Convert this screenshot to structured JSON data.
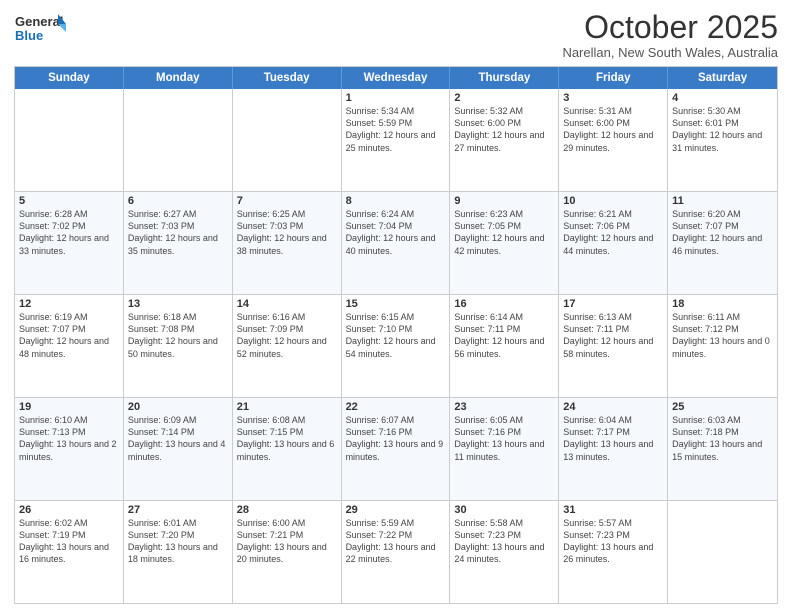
{
  "logo": {
    "line1": "General",
    "line2": "Blue"
  },
  "title": "October 2025",
  "location": "Narellan, New South Wales, Australia",
  "days_of_week": [
    "Sunday",
    "Monday",
    "Tuesday",
    "Wednesday",
    "Thursday",
    "Friday",
    "Saturday"
  ],
  "weeks": [
    [
      {
        "day": "",
        "sunrise": "",
        "sunset": "",
        "daylight": ""
      },
      {
        "day": "",
        "sunrise": "",
        "sunset": "",
        "daylight": ""
      },
      {
        "day": "",
        "sunrise": "",
        "sunset": "",
        "daylight": ""
      },
      {
        "day": "1",
        "sunrise": "Sunrise: 5:34 AM",
        "sunset": "Sunset: 5:59 PM",
        "daylight": "Daylight: 12 hours and 25 minutes."
      },
      {
        "day": "2",
        "sunrise": "Sunrise: 5:32 AM",
        "sunset": "Sunset: 6:00 PM",
        "daylight": "Daylight: 12 hours and 27 minutes."
      },
      {
        "day": "3",
        "sunrise": "Sunrise: 5:31 AM",
        "sunset": "Sunset: 6:00 PM",
        "daylight": "Daylight: 12 hours and 29 minutes."
      },
      {
        "day": "4",
        "sunrise": "Sunrise: 5:30 AM",
        "sunset": "Sunset: 6:01 PM",
        "daylight": "Daylight: 12 hours and 31 minutes."
      }
    ],
    [
      {
        "day": "5",
        "sunrise": "Sunrise: 6:28 AM",
        "sunset": "Sunset: 7:02 PM",
        "daylight": "Daylight: 12 hours and 33 minutes."
      },
      {
        "day": "6",
        "sunrise": "Sunrise: 6:27 AM",
        "sunset": "Sunset: 7:03 PM",
        "daylight": "Daylight: 12 hours and 35 minutes."
      },
      {
        "day": "7",
        "sunrise": "Sunrise: 6:25 AM",
        "sunset": "Sunset: 7:03 PM",
        "daylight": "Daylight: 12 hours and 38 minutes."
      },
      {
        "day": "8",
        "sunrise": "Sunrise: 6:24 AM",
        "sunset": "Sunset: 7:04 PM",
        "daylight": "Daylight: 12 hours and 40 minutes."
      },
      {
        "day": "9",
        "sunrise": "Sunrise: 6:23 AM",
        "sunset": "Sunset: 7:05 PM",
        "daylight": "Daylight: 12 hours and 42 minutes."
      },
      {
        "day": "10",
        "sunrise": "Sunrise: 6:21 AM",
        "sunset": "Sunset: 7:06 PM",
        "daylight": "Daylight: 12 hours and 44 minutes."
      },
      {
        "day": "11",
        "sunrise": "Sunrise: 6:20 AM",
        "sunset": "Sunset: 7:07 PM",
        "daylight": "Daylight: 12 hours and 46 minutes."
      }
    ],
    [
      {
        "day": "12",
        "sunrise": "Sunrise: 6:19 AM",
        "sunset": "Sunset: 7:07 PM",
        "daylight": "Daylight: 12 hours and 48 minutes."
      },
      {
        "day": "13",
        "sunrise": "Sunrise: 6:18 AM",
        "sunset": "Sunset: 7:08 PM",
        "daylight": "Daylight: 12 hours and 50 minutes."
      },
      {
        "day": "14",
        "sunrise": "Sunrise: 6:16 AM",
        "sunset": "Sunset: 7:09 PM",
        "daylight": "Daylight: 12 hours and 52 minutes."
      },
      {
        "day": "15",
        "sunrise": "Sunrise: 6:15 AM",
        "sunset": "Sunset: 7:10 PM",
        "daylight": "Daylight: 12 hours and 54 minutes."
      },
      {
        "day": "16",
        "sunrise": "Sunrise: 6:14 AM",
        "sunset": "Sunset: 7:11 PM",
        "daylight": "Daylight: 12 hours and 56 minutes."
      },
      {
        "day": "17",
        "sunrise": "Sunrise: 6:13 AM",
        "sunset": "Sunset: 7:11 PM",
        "daylight": "Daylight: 12 hours and 58 minutes."
      },
      {
        "day": "18",
        "sunrise": "Sunrise: 6:11 AM",
        "sunset": "Sunset: 7:12 PM",
        "daylight": "Daylight: 13 hours and 0 minutes."
      }
    ],
    [
      {
        "day": "19",
        "sunrise": "Sunrise: 6:10 AM",
        "sunset": "Sunset: 7:13 PM",
        "daylight": "Daylight: 13 hours and 2 minutes."
      },
      {
        "day": "20",
        "sunrise": "Sunrise: 6:09 AM",
        "sunset": "Sunset: 7:14 PM",
        "daylight": "Daylight: 13 hours and 4 minutes."
      },
      {
        "day": "21",
        "sunrise": "Sunrise: 6:08 AM",
        "sunset": "Sunset: 7:15 PM",
        "daylight": "Daylight: 13 hours and 6 minutes."
      },
      {
        "day": "22",
        "sunrise": "Sunrise: 6:07 AM",
        "sunset": "Sunset: 7:16 PM",
        "daylight": "Daylight: 13 hours and 9 minutes."
      },
      {
        "day": "23",
        "sunrise": "Sunrise: 6:05 AM",
        "sunset": "Sunset: 7:16 PM",
        "daylight": "Daylight: 13 hours and 11 minutes."
      },
      {
        "day": "24",
        "sunrise": "Sunrise: 6:04 AM",
        "sunset": "Sunset: 7:17 PM",
        "daylight": "Daylight: 13 hours and 13 minutes."
      },
      {
        "day": "25",
        "sunrise": "Sunrise: 6:03 AM",
        "sunset": "Sunset: 7:18 PM",
        "daylight": "Daylight: 13 hours and 15 minutes."
      }
    ],
    [
      {
        "day": "26",
        "sunrise": "Sunrise: 6:02 AM",
        "sunset": "Sunset: 7:19 PM",
        "daylight": "Daylight: 13 hours and 16 minutes."
      },
      {
        "day": "27",
        "sunrise": "Sunrise: 6:01 AM",
        "sunset": "Sunset: 7:20 PM",
        "daylight": "Daylight: 13 hours and 18 minutes."
      },
      {
        "day": "28",
        "sunrise": "Sunrise: 6:00 AM",
        "sunset": "Sunset: 7:21 PM",
        "daylight": "Daylight: 13 hours and 20 minutes."
      },
      {
        "day": "29",
        "sunrise": "Sunrise: 5:59 AM",
        "sunset": "Sunset: 7:22 PM",
        "daylight": "Daylight: 13 hours and 22 minutes."
      },
      {
        "day": "30",
        "sunrise": "Sunrise: 5:58 AM",
        "sunset": "Sunset: 7:23 PM",
        "daylight": "Daylight: 13 hours and 24 minutes."
      },
      {
        "day": "31",
        "sunrise": "Sunrise: 5:57 AM",
        "sunset": "Sunset: 7:23 PM",
        "daylight": "Daylight: 13 hours and 26 minutes."
      },
      {
        "day": "",
        "sunrise": "",
        "sunset": "",
        "daylight": ""
      }
    ]
  ]
}
